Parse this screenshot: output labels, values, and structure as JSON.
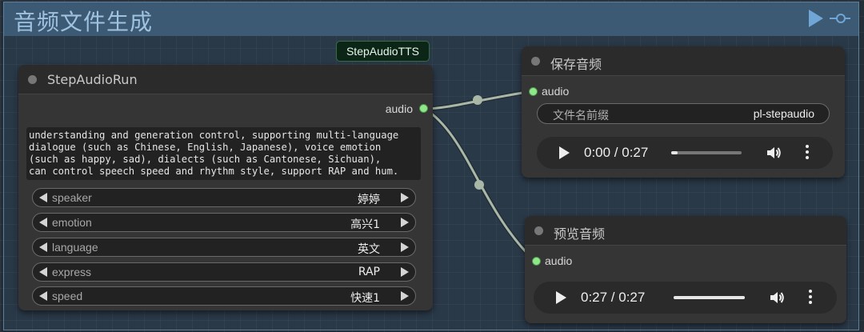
{
  "group": {
    "title": "音频文件生成"
  },
  "badge": {
    "label": "StepAudioTTS"
  },
  "run_node": {
    "title": "StepAudioRun",
    "output_label": "audio",
    "text": "understanding and generation control, supporting multi-language\ndialogue (such as Chinese, English, Japanese), voice emotion\n(such as happy, sad), dialects (such as Cantonese, Sichuan),\ncan control speech speed and rhythm style, support RAP and hum.",
    "widgets": [
      {
        "label": "speaker",
        "value": "婷婷"
      },
      {
        "label": "emotion",
        "value": "高兴1"
      },
      {
        "label": "language",
        "value": "英文"
      },
      {
        "label": "express",
        "value": "RAP"
      },
      {
        "label": "speed",
        "value": "快速1"
      }
    ]
  },
  "save_node": {
    "title": "保存音频",
    "input_label": "audio",
    "prefix_label": "文件名前缀",
    "prefix_value": "pl-stepaudio",
    "player": {
      "time": "0:00 / 0:27",
      "progress": 0.09
    }
  },
  "preview_node": {
    "title": "预览音频",
    "input_label": "audio",
    "player": {
      "time": "0:27 / 0:27",
      "progress": 1.0
    }
  },
  "colors": {
    "link": "#a9b8a6",
    "socket": "#8ee88a",
    "accent": "#6fa6d6"
  }
}
